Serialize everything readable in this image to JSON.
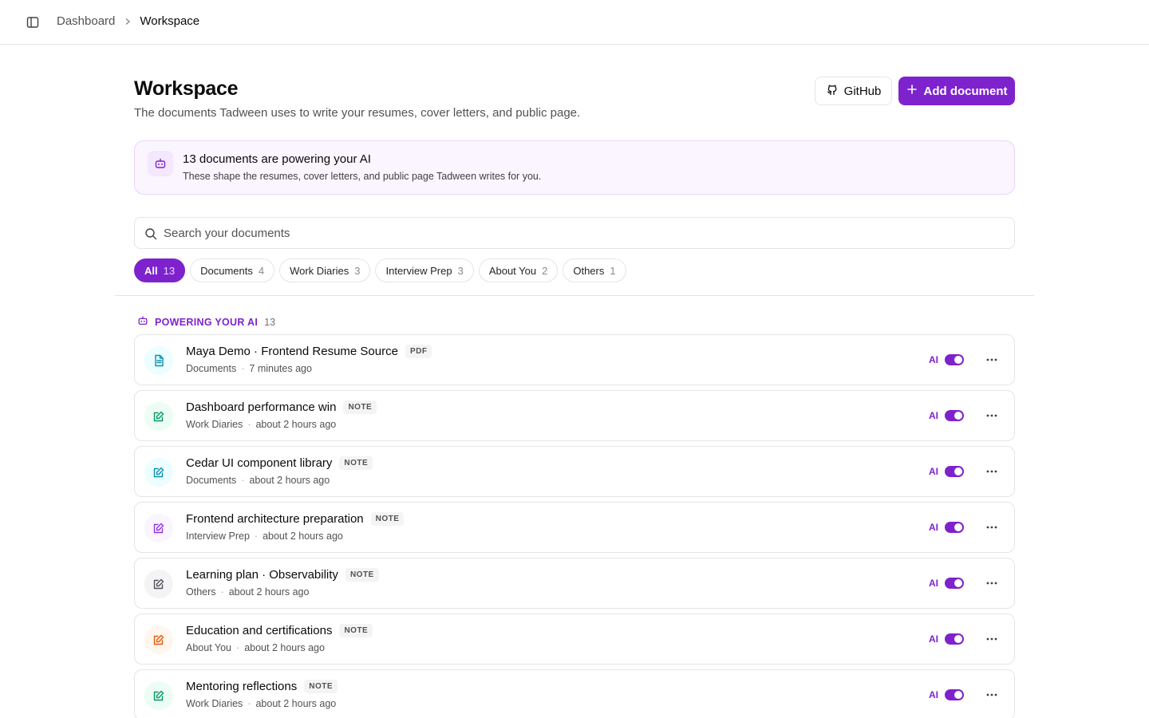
{
  "breadcrumb": {
    "parent": "Dashboard",
    "current": "Workspace"
  },
  "header": {
    "title": "Workspace",
    "subtitle": "The documents Tadween uses to write your resumes, cover letters, and public page.",
    "github_label": "GitHub",
    "add_label": "Add document"
  },
  "banner": {
    "title": "13 documents are powering your AI",
    "text": "These shape the resumes, cover letters, and public page Tadween writes for you."
  },
  "search": {
    "placeholder": "Search your documents",
    "value": ""
  },
  "filters": [
    {
      "label": "All",
      "count": "13",
      "active": true
    },
    {
      "label": "Documents",
      "count": "4",
      "active": false
    },
    {
      "label": "Work Diaries",
      "count": "3",
      "active": false
    },
    {
      "label": "Interview Prep",
      "count": "3",
      "active": false
    },
    {
      "label": "About You",
      "count": "2",
      "active": false
    },
    {
      "label": "Others",
      "count": "1",
      "active": false
    }
  ],
  "section": {
    "label": "POWERING YOUR AI",
    "count": "13"
  },
  "ai_label": "AI",
  "documents": [
    {
      "title": "Maya Demo · Frontend Resume Source",
      "badge": "PDF",
      "category": "Documents",
      "time": "7 minutes ago",
      "icon": "file-text-icon",
      "icon_color": "#0891b2",
      "icon_bg": "#ecfeff",
      "ai_enabled": true
    },
    {
      "title": "Dashboard performance win",
      "badge": "NOTE",
      "category": "Work Diaries",
      "time": "about 2 hours ago",
      "icon": "pencil-square-icon",
      "icon_color": "#059669",
      "icon_bg": "#ecfdf5",
      "ai_enabled": true
    },
    {
      "title": "Cedar UI component library",
      "badge": "NOTE",
      "category": "Documents",
      "time": "about 2 hours ago",
      "icon": "pencil-square-icon",
      "icon_color": "#0891b2",
      "icon_bg": "#ecfeff",
      "ai_enabled": true
    },
    {
      "title": "Frontend architecture preparation",
      "badge": "NOTE",
      "category": "Interview Prep",
      "time": "about 2 hours ago",
      "icon": "pencil-square-icon",
      "icon_color": "#9333ea",
      "icon_bg": "#faf5ff",
      "ai_enabled": true
    },
    {
      "title": "Learning plan · Observability",
      "badge": "NOTE",
      "category": "Others",
      "time": "about 2 hours ago",
      "icon": "pencil-square-icon",
      "icon_color": "#52525b",
      "icon_bg": "#f4f4f5",
      "ai_enabled": true
    },
    {
      "title": "Education and certifications",
      "badge": "NOTE",
      "category": "About You",
      "time": "about 2 hours ago",
      "icon": "pencil-square-icon",
      "icon_color": "#ea580c",
      "icon_bg": "#fff7ed",
      "ai_enabled": true
    },
    {
      "title": "Mentoring reflections",
      "badge": "NOTE",
      "category": "Work Diaries",
      "time": "about 2 hours ago",
      "icon": "pencil-square-icon",
      "icon_color": "#059669",
      "icon_bg": "#ecfdf5",
      "ai_enabled": true
    }
  ],
  "colors": {
    "accent": "#7e22ce",
    "border": "#e5e5e5",
    "banner_bg": "#faf5ff"
  }
}
